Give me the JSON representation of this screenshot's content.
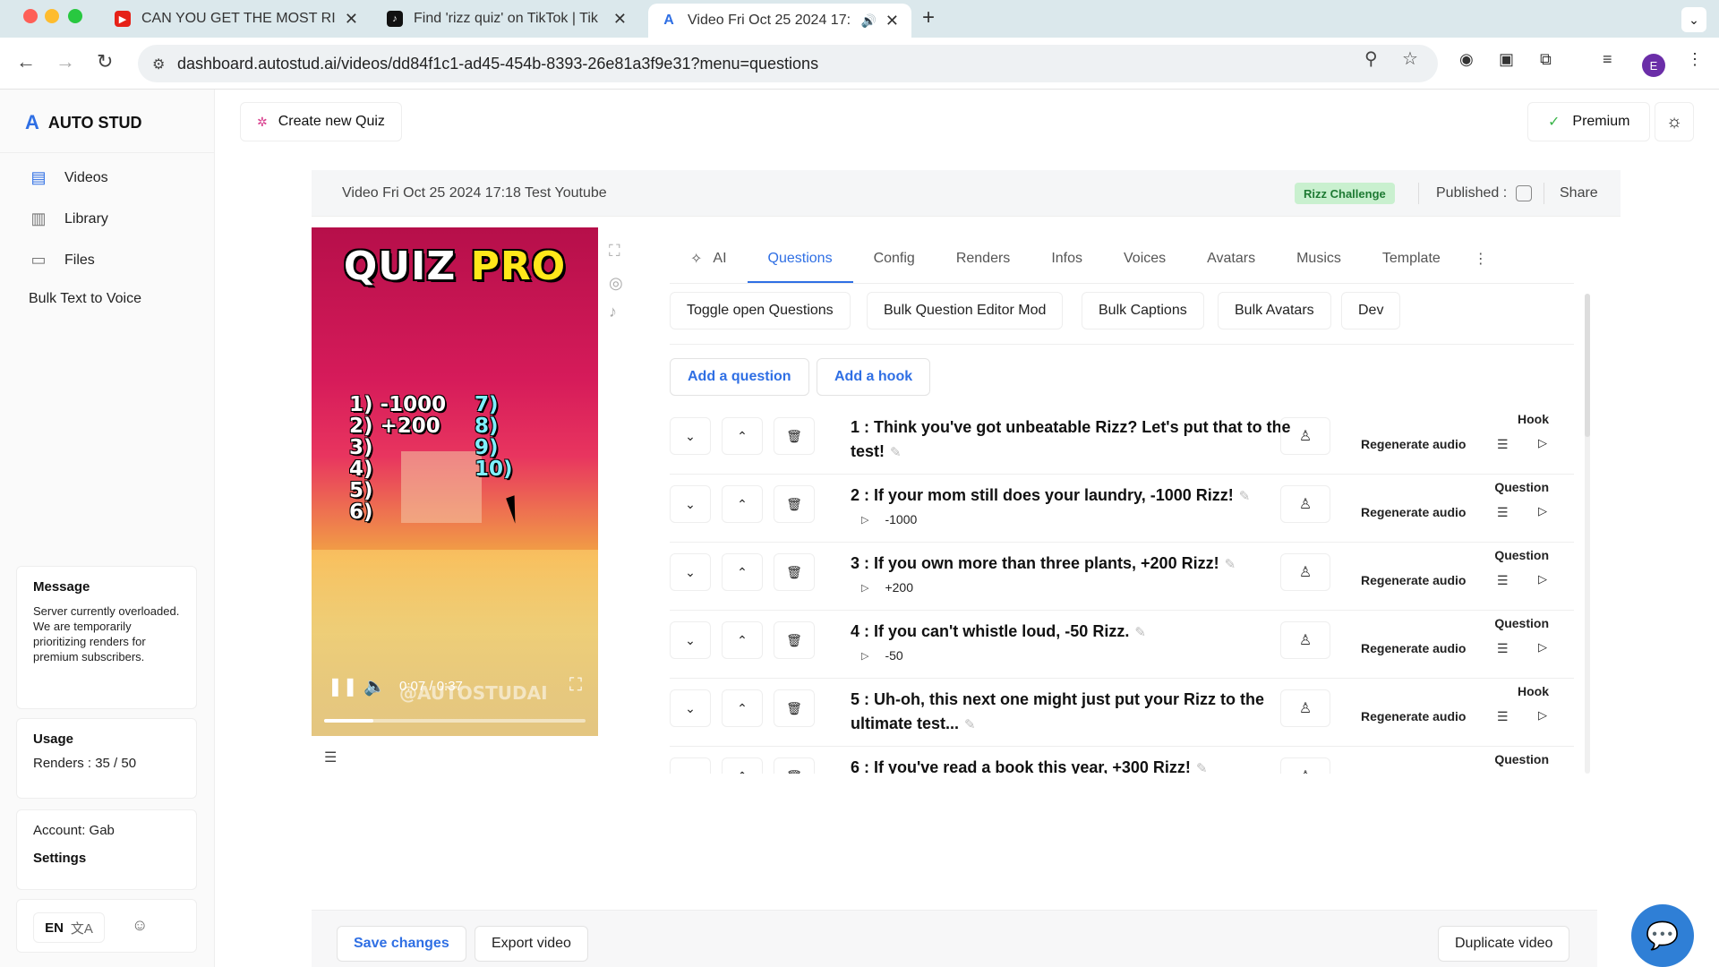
{
  "browser": {
    "tabs": [
      {
        "title": "CAN YOU GET THE MOST RIZ",
        "icon": "youtube-icon",
        "color": "#e62117"
      },
      {
        "title": "Find 'rizz quiz' on TikTok | Tik",
        "icon": "tiktok-icon",
        "color": "#111111"
      },
      {
        "title": "Video Fri Oct 25 2024 17:",
        "icon": "autostud-icon",
        "color": "#2f6fe4"
      }
    ],
    "new_tab": "+",
    "url": "dashboard.autostud.ai/videos/dd84f1c1-ad45-454b-8393-26e81a3f9e31?menu=questions",
    "profile_initial": "E"
  },
  "sidebar": {
    "brand": "AUTO STUD",
    "items": [
      {
        "label": "Videos",
        "icon": "video-icon"
      },
      {
        "label": "Library",
        "icon": "library-icon"
      },
      {
        "label": "Files",
        "icon": "folder-icon"
      },
      {
        "label": "Bulk Text to Voice"
      }
    ],
    "message": {
      "title": "Message",
      "body": "Server currently overloaded. We are temporarily prioritizing renders for premium subscribers."
    },
    "usage": {
      "title": "Usage",
      "renders": "Renders : 35 / 50"
    },
    "account": {
      "label": "Account: Gab",
      "settings": "Settings"
    },
    "lang": "EN"
  },
  "header": {
    "create_quiz": "Create new Quiz",
    "premium": "Premium"
  },
  "video": {
    "title": "Video Fri Oct 25 2024 17:18 Test Youtube",
    "badge": "Rizz Challenge",
    "published_label": "Published :",
    "share": "Share",
    "preview": {
      "title_white": "QUIZ",
      "title_yellow": "PRO",
      "answers_left": "1) -1000\n2) +200\n3)\n4)\n5)\n6)",
      "answers_right": "7)\n8)\n9)\n10)",
      "watermark": "@AUTOSTUDAI",
      "time": "0:07 / 0:37",
      "progress": 0.19
    }
  },
  "tabs": [
    {
      "label": "AI"
    },
    {
      "label": "Questions",
      "active": true
    },
    {
      "label": "Config"
    },
    {
      "label": "Renders"
    },
    {
      "label": "Infos"
    },
    {
      "label": "Voices"
    },
    {
      "label": "Avatars"
    },
    {
      "label": "Musics"
    },
    {
      "label": "Template"
    }
  ],
  "actions": [
    "Toggle open Questions",
    "Bulk Question Editor Mod",
    "Bulk Captions",
    "Bulk Avatars",
    "Dev"
  ],
  "add_question": "Add a question",
  "add_hook": "Add a hook",
  "regenerate_label": "Regenerate audio",
  "questions": [
    {
      "text": "1 : Think you've got unbeatable Rizz? Let's put that to the test!",
      "type": "Hook",
      "answer": ""
    },
    {
      "text": "2 : If your mom still does your laundry, -1000 Rizz!",
      "type": "Question",
      "answer": "-1000"
    },
    {
      "text": "3 : If you own more than three plants, +200 Rizz!",
      "type": "Question",
      "answer": "+200"
    },
    {
      "text": "4 : If you can't whistle loud, -50 Rizz.",
      "type": "Question",
      "answer": "-50"
    },
    {
      "text": "5 : Uh-oh, this next one might just put your Rizz to the ultimate test...",
      "type": "Hook",
      "answer": ""
    },
    {
      "text": "6 : If you've read a book this year, +300 Rizz!",
      "type": "Question",
      "answer": ""
    }
  ],
  "footer": {
    "save": "Save changes",
    "export": "Export video",
    "duplicate": "Duplicate video"
  }
}
